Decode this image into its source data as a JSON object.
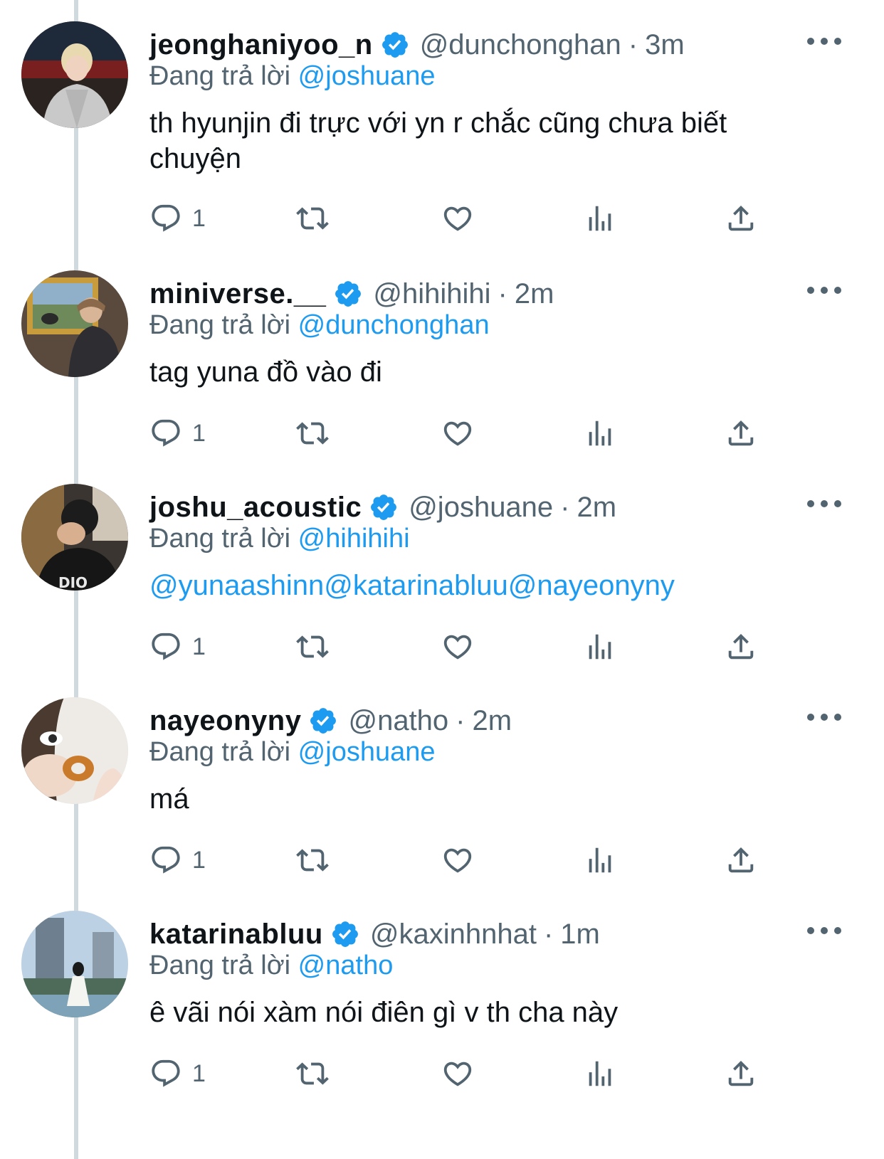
{
  "colors": {
    "link": "#1d9bf0",
    "secondary": "#536471",
    "text": "#0f1419",
    "verified": "#1d9bf0",
    "thread_line": "#cfd9de"
  },
  "replying_prefix": "Đang trả lời",
  "icons": [
    "reply-icon",
    "retweet-icon",
    "like-icon",
    "views-icon",
    "share-icon",
    "more-icon",
    "verified-badge-icon"
  ],
  "tweets": [
    {
      "name": "jeonghaniyoo_n",
      "handle": "@dunchonghan",
      "separator": "·",
      "time": "3m",
      "replying_to": "@joshuane",
      "text": "th hyunjin đi trực với yn r chắc cũng chưa biết chuyện",
      "reply_count": "1"
    },
    {
      "name": "miniverse.__",
      "handle": "@hihihihi",
      "separator": "·",
      "time": "2m",
      "replying_to": "@dunchonghan",
      "text": "tag yuna đồ vào đi",
      "reply_count": "1"
    },
    {
      "name": "joshu_acoustic",
      "handle": "@joshuane",
      "separator": "·",
      "time": "2m",
      "replying_to": "@hihihihi",
      "text": "@yunaashinn@katarinabluu@nayeonyny",
      "reply_count": "1"
    },
    {
      "name": "nayeonyny",
      "handle": "@natho",
      "separator": "·",
      "time": "2m",
      "replying_to": "@joshuane",
      "text": "má",
      "reply_count": "1"
    },
    {
      "name": "katarinabluu",
      "handle": "@kaxinhnhat",
      "separator": "·",
      "time": "1m",
      "replying_to": "@natho",
      "text": "ê vãi nói xàm nói điên gì v th cha này",
      "reply_count": "1"
    }
  ]
}
